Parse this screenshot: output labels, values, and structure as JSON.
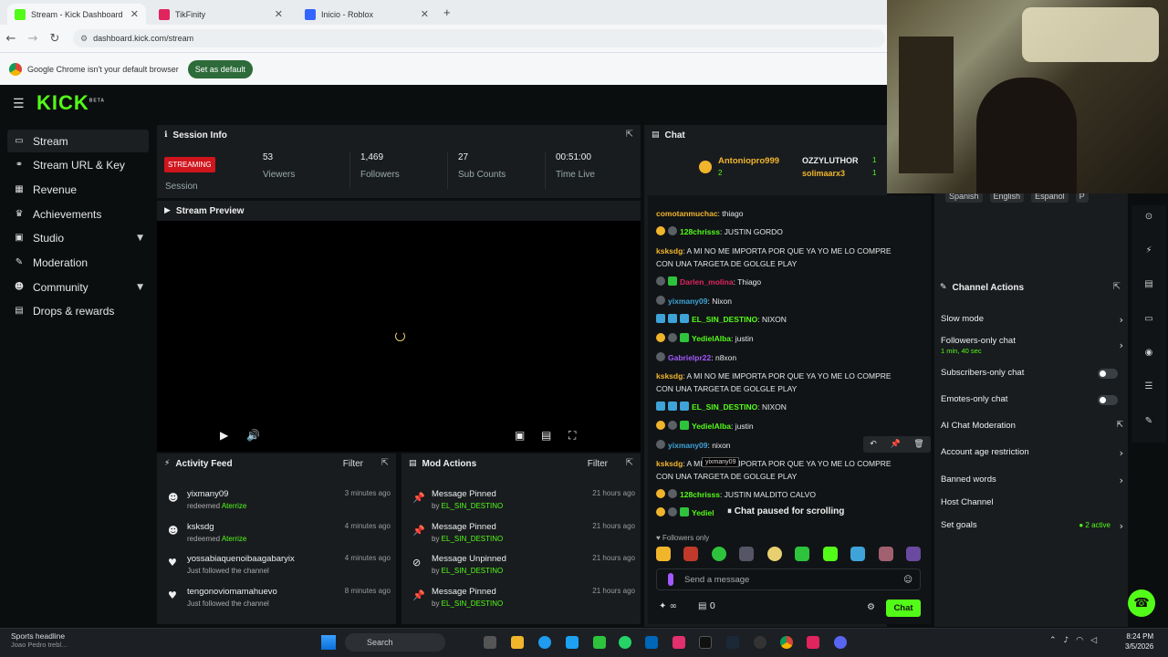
{
  "browser": {
    "tabs": [
      {
        "label": "Stream - Kick Dashboard",
        "color": "#53fc18"
      },
      {
        "label": "TikFinity",
        "color": "#e0245e"
      },
      {
        "label": "Inicio - Roblox",
        "color": "#3366ff"
      }
    ],
    "new_tab": "+",
    "url": "dashboard.kick.com/stream",
    "infobar_text": "Google Chrome isn't your default browser",
    "infobar_button": "Set as default"
  },
  "app": {
    "logo": "KICK",
    "logo_badge": "BETA"
  },
  "sidebar": {
    "items": [
      {
        "label": "Stream",
        "icon": "video-icon"
      },
      {
        "label": "Stream URL & Key",
        "icon": "link-icon"
      },
      {
        "label": "Revenue",
        "icon": "dollar-icon"
      },
      {
        "label": "Achievements",
        "icon": "trophy-icon"
      },
      {
        "label": "Studio",
        "icon": "camera-icon"
      },
      {
        "label": "Moderation",
        "icon": "wrench-icon"
      },
      {
        "label": "Community",
        "icon": "people-icon"
      },
      {
        "label": "Drops & rewards",
        "icon": "gift-icon"
      }
    ]
  },
  "session": {
    "title": "Session Info",
    "status": "STREAMING",
    "status_label": "Session",
    "stats": [
      {
        "value": "53",
        "label": "Viewers"
      },
      {
        "value": "1,469",
        "label": "Followers"
      },
      {
        "value": "27",
        "label": "Sub Counts"
      },
      {
        "value": "00:51:00",
        "label": "Time Live"
      }
    ]
  },
  "preview": {
    "title": "Stream Preview"
  },
  "activity": {
    "title": "Activity Feed",
    "filter": "Filter",
    "items": [
      {
        "name": "yixmany09",
        "sub_prefix": "redeemed ",
        "sub_hl": "Aterrize",
        "time": "3 minutes ago",
        "icon": "user-icon"
      },
      {
        "name": "ksksdg",
        "sub_prefix": "redeemed ",
        "sub_hl": "Aterrize",
        "time": "4 minutes ago",
        "icon": "user-icon"
      },
      {
        "name": "yossabiaquenoibaagabaryix",
        "sub_prefix": "Just followed the channel",
        "sub_hl": "",
        "time": "4 minutes ago",
        "icon": "heart-icon"
      },
      {
        "name": "tengonoviomamahuevo",
        "sub_prefix": "Just followed the channel",
        "sub_hl": "",
        "time": "8 minutes ago",
        "icon": "heart-icon"
      }
    ]
  },
  "mod": {
    "title": "Mod Actions",
    "filter": "Filter",
    "items": [
      {
        "name": "Message Pinned",
        "by": "by ",
        "who": "EL_SIN_DESTINO",
        "time": "21 hours ago"
      },
      {
        "name": "Message Pinned",
        "by": "by ",
        "who": "EL_SIN_DESTINO",
        "time": "21 hours ago"
      },
      {
        "name": "Message Unpinned",
        "by": "by ",
        "who": "EL_SIN_DESTINO",
        "time": "21 hours ago"
      },
      {
        "name": "Message Pinned",
        "by": "by ",
        "who": "EL_SIN_DESTINO",
        "time": "21 hours ago"
      }
    ]
  },
  "chat": {
    "title": "Chat",
    "top_users": [
      {
        "name": "Antoniopro999",
        "count": "2"
      },
      {
        "name": "OZZYLUTHOR",
        "count": "1"
      },
      {
        "name": "solimaarx3",
        "count": "1"
      }
    ],
    "messages": [
      {
        "user": "comotanmuchac",
        "color": "#f1b52c",
        "text": ": thiago",
        "badges": []
      },
      {
        "user": "128chrisss",
        "color": "#53fc18",
        "text": ": JUSTIN GORDO",
        "badges": [
          "o",
          "s"
        ]
      },
      {
        "user": "ksksdg",
        "color": "#f1b52c",
        "text": ": A MI NO ME IMPORTA POR QUE YA YO ME LO COMPRE",
        "badges": []
      },
      {
        "user": "",
        "color": "#e6e6e6",
        "text": "CON UNA TARGETA DE GOLGLE PLAY",
        "badges": []
      },
      {
        "user": "Darlen_molina",
        "color": "#e0245e",
        "text": ": Thiago",
        "badges": [
          "s",
          "g"
        ]
      },
      {
        "user": "yixmany09",
        "color": "#3ea3d8",
        "text": ": Nixon",
        "badges": [
          "s"
        ]
      },
      {
        "user": "EL_SIN_DESTINO",
        "color": "#53fc18",
        "text": ": NIXON",
        "badges": [
          "b",
          "b",
          "b"
        ]
      },
      {
        "user": "YedielAlba",
        "color": "#53fc18",
        "text": ": justin",
        "badges": [
          "o",
          "s",
          "g"
        ]
      },
      {
        "user": "Gabrielpr22",
        "color": "#a259ff",
        "text": ": n8xon",
        "badges": [
          "s"
        ]
      },
      {
        "user": "ksksdg",
        "color": "#f1b52c",
        "text": ": A MI NO ME IMPORTA POR QUE YA YO ME LO COMPRE",
        "badges": []
      },
      {
        "user": "",
        "color": "#e6e6e6",
        "text": "CON UNA TARGETA DE GOLGLE PLAY",
        "badges": []
      },
      {
        "user": "EL_SIN_DESTINO",
        "color": "#53fc18",
        "text": ": NIXON",
        "badges": [
          "b",
          "b",
          "b"
        ]
      },
      {
        "user": "YedielAlba",
        "color": "#53fc18",
        "text": ": justin",
        "badges": [
          "o",
          "s",
          "g"
        ]
      },
      {
        "user": "yixmany09",
        "color": "#3ea3d8",
        "text": ": nixon",
        "badges": [
          "s"
        ]
      },
      {
        "user": "ksksdg",
        "color": "#f1b52c",
        "text": ": A MI NO ME IMPORTA POR QUE YA YO ME LO COMPRE",
        "badges": []
      },
      {
        "user": "",
        "color": "#e6e6e6",
        "text": "CON UNA TARGETA DE GOLGLE PLAY",
        "badges": []
      },
      {
        "user": "128chrisss",
        "color": "#53fc18",
        "text": ": JUSTIN MALDITO CALVO",
        "badges": [
          "o",
          "s"
        ]
      },
      {
        "user": "Yediel",
        "color": "#53fc18",
        "text": "",
        "badges": [
          "o",
          "s",
          "g"
        ]
      }
    ],
    "tooltip": "yixmany09",
    "paused": "Chat paused for scrolling",
    "followers_only": "Followers only",
    "input_placeholder": "Send a message",
    "points": "∞",
    "gift_count": "0",
    "send_button": "Chat"
  },
  "languages": [
    "Spanish",
    "English",
    "Espanol",
    "P"
  ],
  "channel_actions": {
    "title": "Channel Actions",
    "items": [
      {
        "label": "Slow mode",
        "sub": "",
        "control": "arrow"
      },
      {
        "label": "Followers-only chat",
        "sub": "1 min, 40 sec",
        "control": "arrow"
      },
      {
        "label": "Subscribers-only chat",
        "sub": "",
        "control": "toggle"
      },
      {
        "label": "Emotes-only chat",
        "sub": "",
        "control": "toggle"
      },
      {
        "label": "AI Chat Moderation",
        "sub": "",
        "control": "external"
      },
      {
        "label": "Account age restriction",
        "sub": "",
        "control": "arrow"
      },
      {
        "label": "Banned words",
        "sub": "",
        "control": "arrow"
      },
      {
        "label": "Host Channel",
        "sub": "",
        "control": "none"
      },
      {
        "label": "Set goals",
        "sub": "",
        "control": "arrow",
        "extra": "2 active"
      }
    ]
  },
  "taskbar": {
    "weather_title": "Sports headline",
    "weather_sub": "Joao Pedro trebl...",
    "search": "Search",
    "time": "8:24 PM",
    "date": "3/5/2026"
  }
}
